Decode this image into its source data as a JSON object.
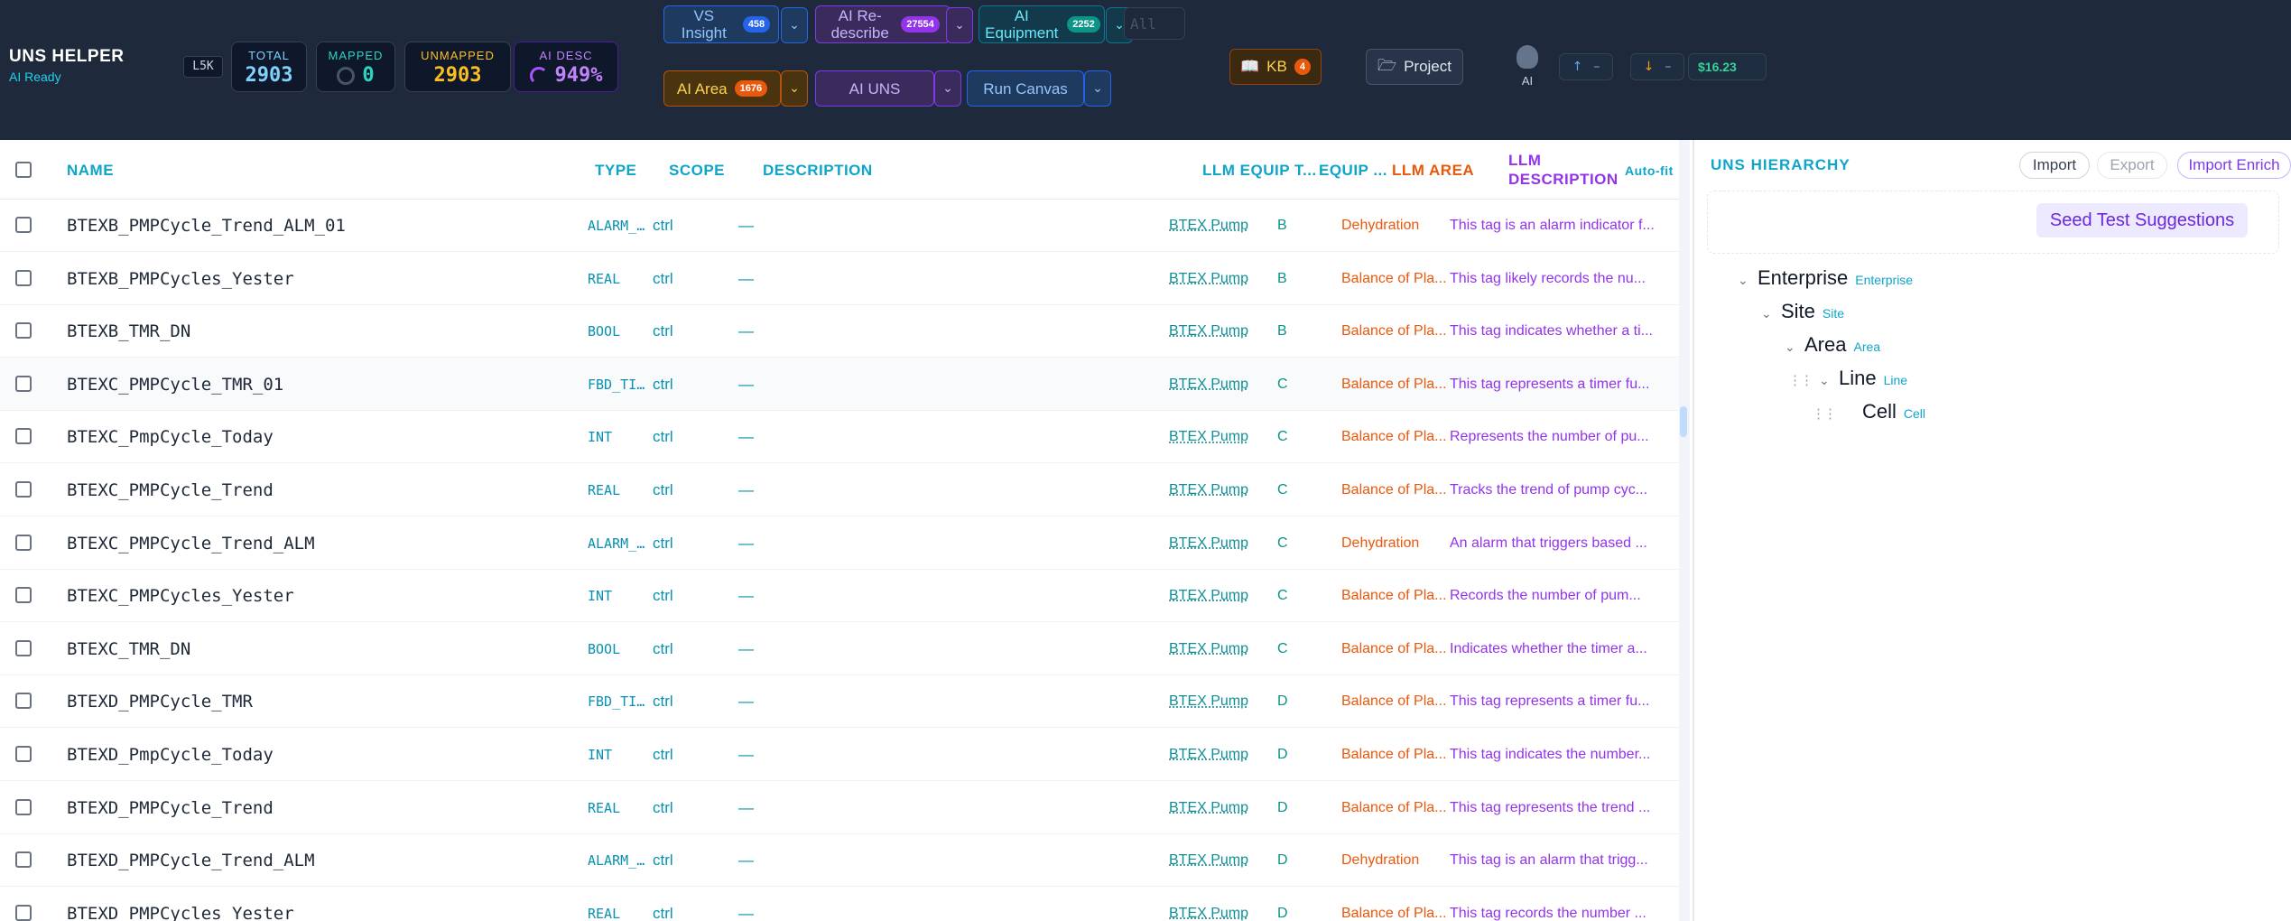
{
  "brand": {
    "title": "UNS HELPER",
    "status": "AI Ready"
  },
  "header": {
    "chip": "L5K",
    "stats": [
      {
        "label": "TOTAL",
        "value": "2903",
        "color": "#7dd3fc"
      },
      {
        "label": "MAPPED",
        "value": "0",
        "color": "#2dd4bf"
      },
      {
        "label": "UNMAPPED",
        "value": "2903",
        "color": "#fbbf24"
      },
      {
        "label": "AI DESC",
        "value": "949%",
        "color": "#c084fc"
      }
    ],
    "buttons": {
      "vs_insight": "VS Insight",
      "vs_insight_count": "458",
      "ai_redescribe": "AI Re-describe",
      "ai_redescribe_count": "27554",
      "ai_equipment": "AI Equipment",
      "ai_equipment_count": "2252",
      "filter_placeholder": "All",
      "ai_area": "AI Area",
      "ai_area_count": "1676",
      "ai_uns": "AI UNS",
      "run_canvas": "Run Canvas",
      "kb": "KB",
      "kb_count": "4",
      "project": "Project",
      "ai_label": "AI",
      "up_dash": "–",
      "down_dash": "–",
      "cost": "$16.23"
    }
  },
  "table": {
    "columns": {
      "name": "NAME",
      "type": "TYPE",
      "scope": "SCOPE",
      "description": "DESCRIPTION",
      "llm_equip_type": "LLM EQUIP T...",
      "equip": "EQUIP ...",
      "llm_area": "LLM AREA",
      "llm_description": "LLM DESCRIPTION",
      "autofit": "Auto-fit"
    },
    "rows": [
      {
        "name": "BTEXB_PMPCycle_Trend_ALM_01",
        "type": "ALARM_...",
        "scope": "ctrl",
        "desc": "—",
        "equip": "BTEX Pump",
        "code": "B",
        "area": "Dehydration",
        "llm": "This tag is an alarm indicator f..."
      },
      {
        "name": "BTEXB_PMPCycles_Yester",
        "type": "REAL",
        "scope": "ctrl",
        "desc": "—",
        "equip": "BTEX Pump",
        "code": "B",
        "area": "Balance of Pla...",
        "llm": "This tag likely records the nu..."
      },
      {
        "name": "BTEXB_TMR_DN",
        "type": "BOOL",
        "scope": "ctrl",
        "desc": "—",
        "equip": "BTEX Pump",
        "code": "B",
        "area": "Balance of Pla...",
        "llm": "This tag indicates whether a ti..."
      },
      {
        "name": "BTEXC_PMPCycle_TMR_01",
        "type": "FBD_TI...",
        "scope": "ctrl",
        "desc": "—",
        "equip": "BTEX Pump",
        "code": "C",
        "area": "Balance of Pla...",
        "llm": "This tag represents a timer fu..."
      },
      {
        "name": "BTEXC_PmpCycle_Today",
        "type": "INT",
        "scope": "ctrl",
        "desc": "—",
        "equip": "BTEX Pump",
        "code": "C",
        "area": "Balance of Pla...",
        "llm": "Represents the number of pu..."
      },
      {
        "name": "BTEXC_PMPCycle_Trend",
        "type": "REAL",
        "scope": "ctrl",
        "desc": "—",
        "equip": "BTEX Pump",
        "code": "C",
        "area": "Balance of Pla...",
        "llm": "Tracks the trend of pump cyc..."
      },
      {
        "name": "BTEXC_PMPCycle_Trend_ALM",
        "type": "ALARM_...",
        "scope": "ctrl",
        "desc": "—",
        "equip": "BTEX Pump",
        "code": "C",
        "area": "Dehydration",
        "llm": "An alarm that triggers based ..."
      },
      {
        "name": "BTEXC_PMPCycles_Yester",
        "type": "INT",
        "scope": "ctrl",
        "desc": "—",
        "equip": "BTEX Pump",
        "code": "C",
        "area": "Balance of Pla...",
        "llm": "Records the number of pum..."
      },
      {
        "name": "BTEXC_TMR_DN",
        "type": "BOOL",
        "scope": "ctrl",
        "desc": "—",
        "equip": "BTEX Pump",
        "code": "C",
        "area": "Balance of Pla...",
        "llm": "Indicates whether the timer a..."
      },
      {
        "name": "BTEXD_PMPCycle_TMR",
        "type": "FBD_TI...",
        "scope": "ctrl",
        "desc": "—",
        "equip": "BTEX Pump",
        "code": "D",
        "area": "Balance of Pla...",
        "llm": "This tag represents a timer fu..."
      },
      {
        "name": "BTEXD_PmpCycle_Today",
        "type": "INT",
        "scope": "ctrl",
        "desc": "—",
        "equip": "BTEX Pump",
        "code": "D",
        "area": "Balance of Pla...",
        "llm": "This tag indicates the number..."
      },
      {
        "name": "BTEXD_PMPCycle_Trend",
        "type": "REAL",
        "scope": "ctrl",
        "desc": "—",
        "equip": "BTEX Pump",
        "code": "D",
        "area": "Balance of Pla...",
        "llm": "This tag represents the trend ..."
      },
      {
        "name": "BTEXD_PMPCycle_Trend_ALM",
        "type": "ALARM_...",
        "scope": "ctrl",
        "desc": "—",
        "equip": "BTEX Pump",
        "code": "D",
        "area": "Dehydration",
        "llm": "This tag is an alarm that trigg..."
      },
      {
        "name": "BTEXD_PMPCycles_Yester",
        "type": "REAL",
        "scope": "ctrl",
        "desc": "—",
        "equip": "BTEX Pump",
        "code": "D",
        "area": "Balance of Pla...",
        "llm": "This tag records the number ..."
      }
    ]
  },
  "panel": {
    "title": "UNS HIERARCHY",
    "import": "Import",
    "export": "Export",
    "import_enrich": "Import Enrich",
    "seed": "Seed Test Suggestions",
    "tree": [
      {
        "name": "Enterprise",
        "type": "Enterprise"
      },
      {
        "name": "Site",
        "type": "Site"
      },
      {
        "name": "Area",
        "type": "Area"
      },
      {
        "name": "Line",
        "type": "Line"
      },
      {
        "name": "Cell",
        "type": "Cell"
      }
    ]
  }
}
